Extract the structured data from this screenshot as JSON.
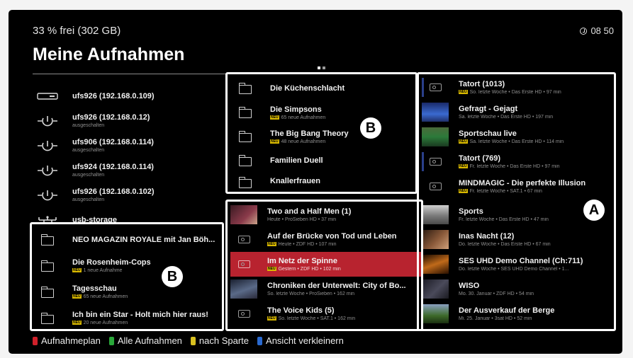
{
  "header": {
    "storage": "33 % frei (302 GB)",
    "clock": "08 50",
    "title": "Meine Aufnahmen"
  },
  "devices": [
    {
      "name": "ufs926 (192.168.0.109)",
      "status": "",
      "icon": "receiver-box-icon"
    },
    {
      "name": "ufs926 (192.168.0.12)",
      "status": "ausgeschalten",
      "icon": "power-plug-icon"
    },
    {
      "name": "ufs906 (192.168.0.114)",
      "status": "ausgeschalten",
      "icon": "power-plug-icon"
    },
    {
      "name": "ufs924 (192.168.0.114)",
      "status": "ausgeschalten",
      "icon": "power-plug-icon"
    },
    {
      "name": "ufs926 (192.168.0.102)",
      "status": "ausgeschalten",
      "icon": "power-plug-icon"
    },
    {
      "name": "usb-storage",
      "status": "",
      "icon": "usb-icon"
    }
  ],
  "left_folders": [
    {
      "name": "NEO MAGAZIN ROYALE mit Jan Böh...",
      "neu": "",
      "sub": ""
    },
    {
      "name": "Die Rosenheim-Cops",
      "neu": "NEU",
      "sub": "1 neue Aufnahme"
    },
    {
      "name": "Tagesschau",
      "neu": "NEU",
      "sub": "65 neue Aufnahmen"
    },
    {
      "name": "Ich bin ein Star - Holt mich hier raus!",
      "neu": "NEU",
      "sub": "20 neue Aufnahmen"
    }
  ],
  "mid_folders": [
    {
      "name": "Die Küchenschlacht",
      "neu": "",
      "sub": ""
    },
    {
      "name": "Die Simpsons",
      "neu": "NEU",
      "sub": "65 neue Aufnahmen"
    },
    {
      "name": "The Big Bang Theory",
      "neu": "NEU",
      "sub": "48 neue Aufnahmen"
    },
    {
      "name": "Familien Duell",
      "neu": "",
      "sub": ""
    },
    {
      "name": "Knallerfrauen",
      "neu": "",
      "sub": ""
    }
  ],
  "mid_recordings": [
    {
      "name": "Two and a Half Men (1)",
      "neu": "",
      "sub": "Heute • ProSieben HD • 37 min",
      "thumb": "#6b2a3a"
    },
    {
      "name": "Auf der Brücke von Tod und Leben",
      "neu": "NEU",
      "sub": "Heute • ZDF HD • 107 min",
      "thumb": ""
    },
    {
      "name": "Im Netz der Spinne",
      "neu": "NEU",
      "sub": "Gestern • ZDF HD • 102 min",
      "thumb": "",
      "selected": true
    },
    {
      "name": "Chroniken der Unterwelt: City of Bo...",
      "neu": "",
      "sub": "So. letzte Woche • ProSieben • 162 min",
      "thumb": "#4a5a70"
    },
    {
      "name": "The Voice Kids (5)",
      "neu": "NEU",
      "sub": "So. letzte Woche • SAT.1 • 162 min",
      "thumb": ""
    }
  ],
  "right_recordings": [
    {
      "name": "Tatort (1013)",
      "neu": "NEU",
      "sub": "So. letzte Woche • Das Erste HD • 97 min",
      "thumb": "",
      "bar": "#2a3f8a"
    },
    {
      "name": "Gefragt - Gejagt",
      "neu": "",
      "sub": "Sa. letzte Woche • Das Erste HD • 197 min",
      "thumb": "#2a4f9a"
    },
    {
      "name": "Sportschau live",
      "neu": "NEU",
      "sub": "Sa. letzte Woche • Das Erste HD • 114 min",
      "thumb": "#2c6a3a"
    },
    {
      "name": "Tatort (769)",
      "neu": "NEU",
      "sub": "Fr. letzte Woche • Das Erste HD • 97 min",
      "thumb": "",
      "bar": "#2a3f8a"
    },
    {
      "name": "MINDMAGIC - Die perfekte Illusion",
      "neu": "NEU",
      "sub": "Fr. letzte Woche • SAT.1 • 67 min",
      "thumb": ""
    },
    {
      "name": "Sports",
      "neu": "",
      "sub": "Fr. letzte Woche • Das Erste HD • 47 min",
      "thumb": "#7a7a7a"
    },
    {
      "name": "Inas Nacht (12)",
      "neu": "",
      "sub": "Do. letzte Woche • Das Erste HD • 67 min",
      "thumb": "#6a4a2a"
    },
    {
      "name": "SES UHD Demo Channel (Ch:711)",
      "neu": "",
      "sub": "Do. letzte Woche • SES UHD Demo Channel • 1...",
      "thumb": "#8a4a1a"
    },
    {
      "name": "WISO",
      "neu": "",
      "sub": "Mo. 30. Januar • ZDF HD • 54 min",
      "thumb": "#3a3a4a"
    },
    {
      "name": "Der Ausverkauf der Berge",
      "neu": "",
      "sub": "Mi. 25. Januar • 3sat HD • 52 min",
      "thumb": "#3d6a2a"
    }
  ],
  "callouts": {
    "a": "A",
    "b": "B"
  },
  "footer": [
    {
      "label": "Aufnahmeplan",
      "color": "#d0202a"
    },
    {
      "label": "Alle Aufnahmen",
      "color": "#2aa83a"
    },
    {
      "label": "nach Sparte",
      "color": "#d8c020"
    },
    {
      "label": "Ansicht verkleinern",
      "color": "#2a6ad0"
    }
  ]
}
